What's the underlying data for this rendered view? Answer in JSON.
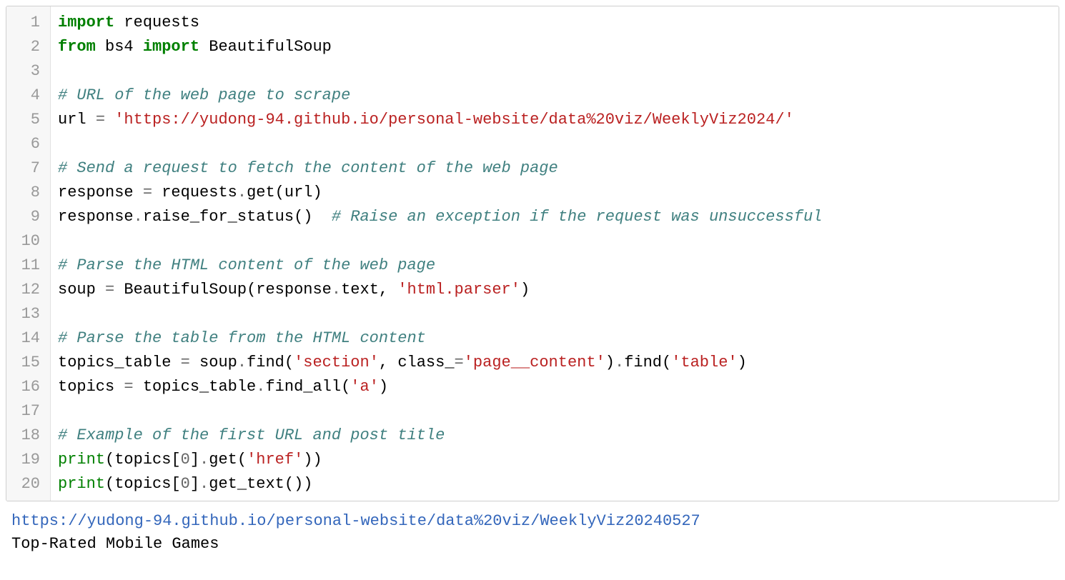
{
  "code": {
    "line_numbers": [
      "1",
      "2",
      "3",
      "4",
      "5",
      "6",
      "7",
      "8",
      "9",
      "10",
      "11",
      "12",
      "13",
      "14",
      "15",
      "16",
      "17",
      "18",
      "19",
      "20"
    ],
    "lines": [
      [
        {
          "t": "keyword",
          "v": "import"
        },
        {
          "t": "sp",
          "v": " "
        },
        {
          "t": "name",
          "v": "requests"
        }
      ],
      [
        {
          "t": "keyword",
          "v": "from"
        },
        {
          "t": "sp",
          "v": " "
        },
        {
          "t": "name",
          "v": "bs4"
        },
        {
          "t": "sp",
          "v": " "
        },
        {
          "t": "keyword",
          "v": "import"
        },
        {
          "t": "sp",
          "v": " "
        },
        {
          "t": "name",
          "v": "BeautifulSoup"
        }
      ],
      [],
      [
        {
          "t": "comment",
          "v": "# URL of the web page to scrape"
        }
      ],
      [
        {
          "t": "name",
          "v": "url"
        },
        {
          "t": "sp",
          "v": " "
        },
        {
          "t": "op",
          "v": "="
        },
        {
          "t": "sp",
          "v": " "
        },
        {
          "t": "string",
          "v": "'https://yudong-94.github.io/personal-website/data%20viz/WeeklyViz2024/'"
        }
      ],
      [],
      [
        {
          "t": "comment",
          "v": "# Send a request to fetch the content of the web page"
        }
      ],
      [
        {
          "t": "name",
          "v": "response"
        },
        {
          "t": "sp",
          "v": " "
        },
        {
          "t": "op",
          "v": "="
        },
        {
          "t": "sp",
          "v": " "
        },
        {
          "t": "name",
          "v": "requests"
        },
        {
          "t": "op",
          "v": "."
        },
        {
          "t": "name",
          "v": "get"
        },
        {
          "t": "punct",
          "v": "("
        },
        {
          "t": "name",
          "v": "url"
        },
        {
          "t": "punct",
          "v": ")"
        }
      ],
      [
        {
          "t": "name",
          "v": "response"
        },
        {
          "t": "op",
          "v": "."
        },
        {
          "t": "name",
          "v": "raise_for_status"
        },
        {
          "t": "punct",
          "v": "()"
        },
        {
          "t": "sp",
          "v": "  "
        },
        {
          "t": "comment",
          "v": "# Raise an exception if the request was unsuccessful"
        }
      ],
      [],
      [
        {
          "t": "comment",
          "v": "# Parse the HTML content of the web page"
        }
      ],
      [
        {
          "t": "name",
          "v": "soup"
        },
        {
          "t": "sp",
          "v": " "
        },
        {
          "t": "op",
          "v": "="
        },
        {
          "t": "sp",
          "v": " "
        },
        {
          "t": "name",
          "v": "BeautifulSoup"
        },
        {
          "t": "punct",
          "v": "("
        },
        {
          "t": "name",
          "v": "response"
        },
        {
          "t": "op",
          "v": "."
        },
        {
          "t": "name",
          "v": "text"
        },
        {
          "t": "punct",
          "v": ","
        },
        {
          "t": "sp",
          "v": " "
        },
        {
          "t": "string",
          "v": "'html.parser'"
        },
        {
          "t": "punct",
          "v": ")"
        }
      ],
      [],
      [
        {
          "t": "comment",
          "v": "# Parse the table from the HTML content"
        }
      ],
      [
        {
          "t": "name",
          "v": "topics_table"
        },
        {
          "t": "sp",
          "v": " "
        },
        {
          "t": "op",
          "v": "="
        },
        {
          "t": "sp",
          "v": " "
        },
        {
          "t": "name",
          "v": "soup"
        },
        {
          "t": "op",
          "v": "."
        },
        {
          "t": "name",
          "v": "find"
        },
        {
          "t": "punct",
          "v": "("
        },
        {
          "t": "string",
          "v": "'section'"
        },
        {
          "t": "punct",
          "v": ","
        },
        {
          "t": "sp",
          "v": " "
        },
        {
          "t": "name",
          "v": "class_"
        },
        {
          "t": "op",
          "v": "="
        },
        {
          "t": "string",
          "v": "'page__content'"
        },
        {
          "t": "punct",
          "v": ")"
        },
        {
          "t": "op",
          "v": "."
        },
        {
          "t": "name",
          "v": "find"
        },
        {
          "t": "punct",
          "v": "("
        },
        {
          "t": "string",
          "v": "'table'"
        },
        {
          "t": "punct",
          "v": ")"
        }
      ],
      [
        {
          "t": "name",
          "v": "topics"
        },
        {
          "t": "sp",
          "v": " "
        },
        {
          "t": "op",
          "v": "="
        },
        {
          "t": "sp",
          "v": " "
        },
        {
          "t": "name",
          "v": "topics_table"
        },
        {
          "t": "op",
          "v": "."
        },
        {
          "t": "name",
          "v": "find_all"
        },
        {
          "t": "punct",
          "v": "("
        },
        {
          "t": "string",
          "v": "'a'"
        },
        {
          "t": "punct",
          "v": ")"
        }
      ],
      [],
      [
        {
          "t": "comment",
          "v": "# Example of the first URL and post title"
        }
      ],
      [
        {
          "t": "builtin",
          "v": "print"
        },
        {
          "t": "punct",
          "v": "("
        },
        {
          "t": "name",
          "v": "topics"
        },
        {
          "t": "punct",
          "v": "["
        },
        {
          "t": "number",
          "v": "0"
        },
        {
          "t": "punct",
          "v": "]"
        },
        {
          "t": "op",
          "v": "."
        },
        {
          "t": "name",
          "v": "get"
        },
        {
          "t": "punct",
          "v": "("
        },
        {
          "t": "string",
          "v": "'href'"
        },
        {
          "t": "punct",
          "v": "))"
        }
      ],
      [
        {
          "t": "builtin",
          "v": "print"
        },
        {
          "t": "punct",
          "v": "("
        },
        {
          "t": "name",
          "v": "topics"
        },
        {
          "t": "punct",
          "v": "["
        },
        {
          "t": "number",
          "v": "0"
        },
        {
          "t": "punct",
          "v": "]"
        },
        {
          "t": "op",
          "v": "."
        },
        {
          "t": "name",
          "v": "get_text"
        },
        {
          "t": "punct",
          "v": "())"
        }
      ]
    ]
  },
  "output": {
    "url": "https://yudong-94.github.io/personal-website/data%20viz/WeeklyViz20240527",
    "title": "Top-Rated Mobile Games"
  }
}
